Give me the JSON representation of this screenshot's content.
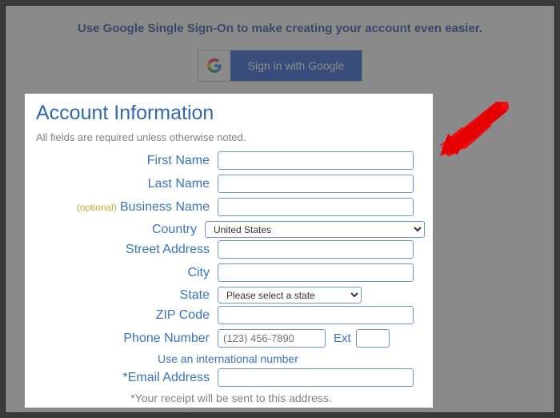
{
  "sso": {
    "banner": "Use Google Single Sign-On to make creating your account even easier.",
    "button_label": "Sign in with Google"
  },
  "card": {
    "heading": "Account Information",
    "required_note": "All fields are required unless otherwise noted.",
    "optional_tag": "(optional)",
    "labels": {
      "first_name": "First Name",
      "last_name": "Last Name",
      "business_name": "Business Name",
      "country": "Country",
      "street_address": "Street Address",
      "city": "City",
      "state": "State",
      "zip": "ZIP Code",
      "phone": "Phone Number",
      "ext": "Ext",
      "email": "*Email Address"
    },
    "values": {
      "first_name": "",
      "last_name": "",
      "business_name": "",
      "country_selected": "United States",
      "street_address": "",
      "city": "",
      "state_selected": "Please select a state",
      "zip": "",
      "phone": "",
      "ext": "",
      "email": ""
    },
    "placeholders": {
      "phone": "(123) 456-7890"
    },
    "intl_link": "Use an international number",
    "receipt_note": "*Your receipt will be sent to this address."
  }
}
